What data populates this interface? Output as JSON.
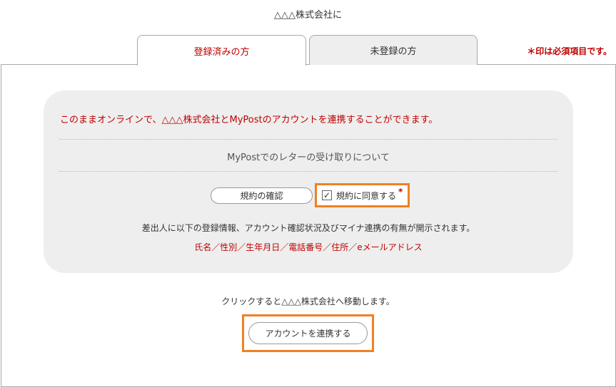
{
  "header": {
    "company_title": "△△△株式会社に"
  },
  "tabs": [
    {
      "label": "登録済みの方",
      "active": true
    },
    {
      "label": "未登録の方",
      "active": false
    }
  ],
  "required_note": "＊印は必須項目です。",
  "info_box": {
    "link_message": "このままオンラインで、△△△株式会社とMyPostのアカウントを連携することができます。",
    "letter_info": "MyPostでのレターの受け取りについて",
    "terms_button": "規約の確認",
    "agree_checkbox": {
      "checked": true,
      "checkmark": "✓",
      "label": "規約に同意する",
      "required_mark": "*"
    },
    "disclosure_text": "差出人に以下の登録情報、アカウント確認状況及びマイナ連携の有無が開示されます。",
    "disclosure_items": "氏名／性別／生年月日／電話番号／住所／eメールアドレス"
  },
  "move_notice": "クリックすると△△△株式会社へ移動します。",
  "link_button": "アカウントを連携する",
  "colors": {
    "accent_red": "#c00000",
    "highlight_orange": "#f08020",
    "box_gray": "#eeeeee"
  }
}
